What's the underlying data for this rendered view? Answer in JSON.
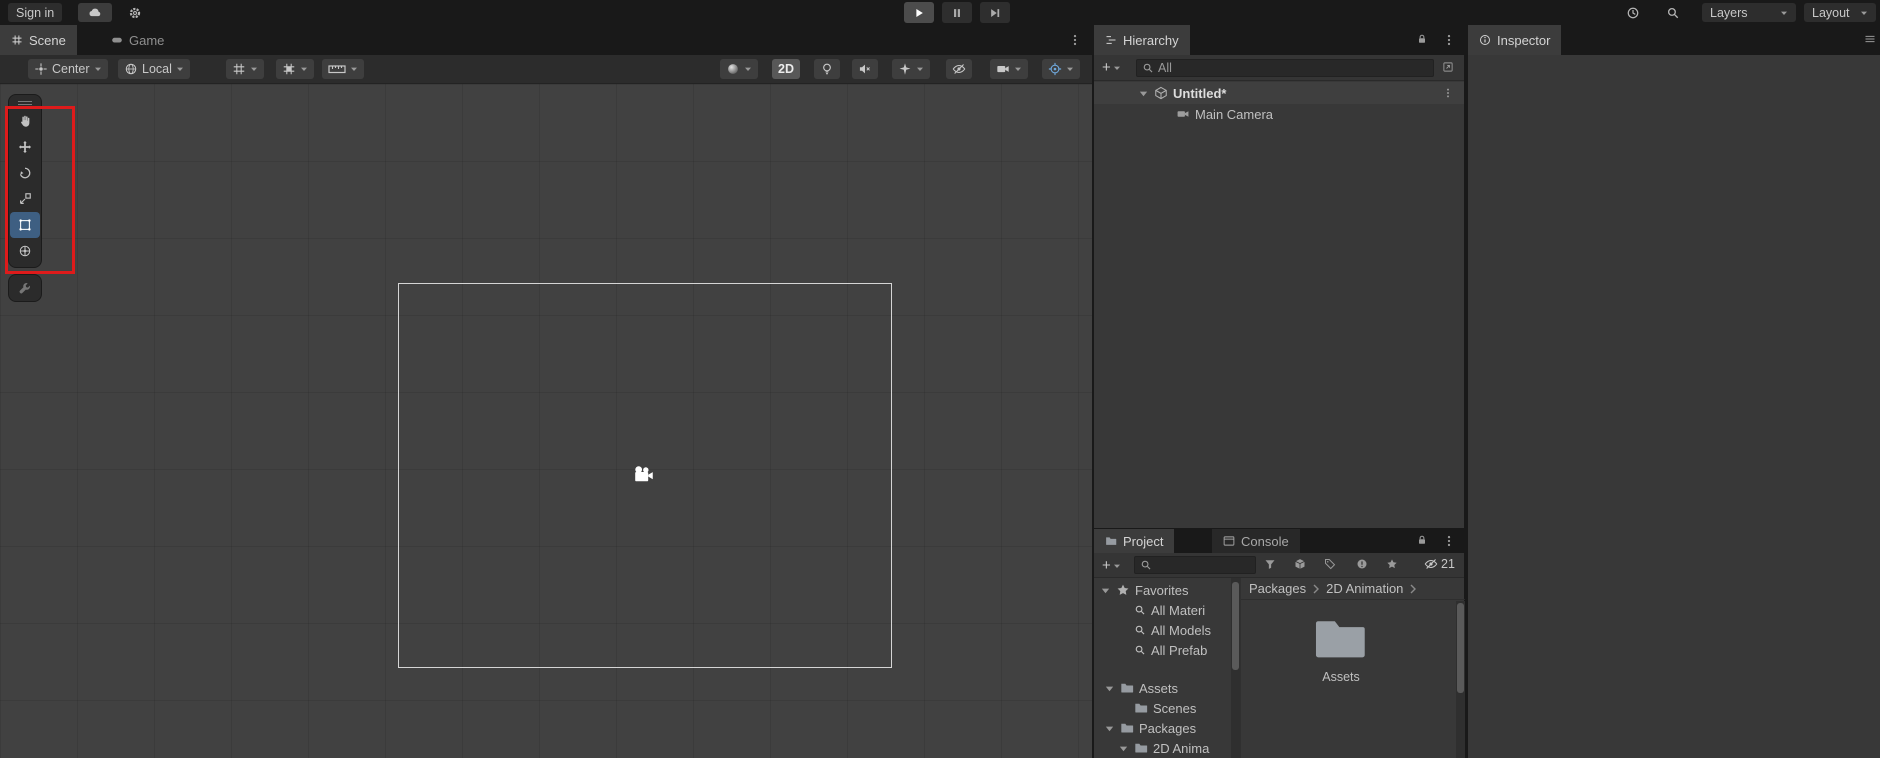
{
  "colors": {
    "annotation_red": "#de1b1b",
    "tool_selected_blue": "#3e5f82",
    "gizmo_blue": "#6fa8dc"
  },
  "topbar": {
    "sign_in_label": "Sign in",
    "layers_label": "Layers",
    "layout_label": "Layout"
  },
  "scene_panel": {
    "tab_scene": "Scene",
    "tab_game": "Game",
    "toolbar": {
      "pivot_label": "Center",
      "orientation_label": "Local",
      "mode_2d_label": "2D"
    }
  },
  "hierarchy_panel": {
    "title": "Hierarchy",
    "add_label": "+",
    "search_value": "All",
    "scene_row_label": "Untitled*",
    "rows": [
      {
        "label": "Main Camera"
      }
    ]
  },
  "inspector_panel": {
    "title": "Inspector"
  },
  "project_panel": {
    "project_tab_label": "Project",
    "console_tab_label": "Console",
    "add_label": "+",
    "hidden_packages_count": "21",
    "favorites_label": "Favorites",
    "favorites_items": [
      {
        "label": "All Materi"
      },
      {
        "label": "All Models"
      },
      {
        "label": "All Prefab"
      }
    ],
    "folders": {
      "assets_label": "Assets",
      "scenes_label": "Scenes",
      "packages_label": "Packages",
      "anim_label": "2D Anima"
    },
    "breadcrumbs": [
      {
        "label": "Packages"
      },
      {
        "label": "2D Animation"
      }
    ],
    "content_items": [
      {
        "label": "Assets"
      }
    ]
  }
}
